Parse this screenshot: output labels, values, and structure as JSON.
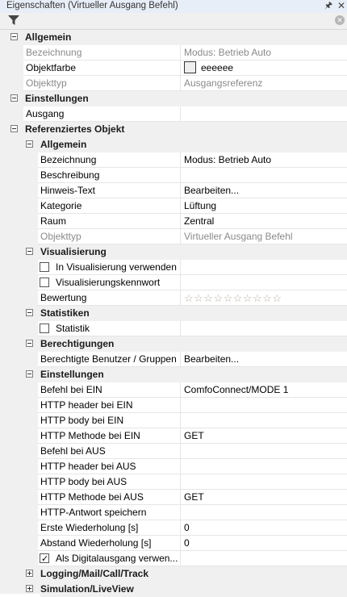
{
  "window": {
    "title": "Eigenschaften (Virtueller Ausgang Befehl)",
    "pin_icon": "pin-icon",
    "close_icon": "close-icon"
  },
  "toolbar": {
    "filter_icon": "filter-icon",
    "clear_icon": "clear-icon"
  },
  "properties": {
    "allgemein": {
      "header": "Allgemein",
      "bezeichnung": {
        "label": "Bezeichnung",
        "value": "Modus: Betrieb Auto"
      },
      "objektfarbe": {
        "label": "Objektfarbe",
        "value": "eeeeee",
        "color": "#eeeeee"
      },
      "objekttyp": {
        "label": "Objekttyp",
        "value": "Ausgangsreferenz"
      }
    },
    "einstellungen": {
      "header": "Einstellungen",
      "ausgang": {
        "label": "Ausgang",
        "value": ""
      }
    },
    "ref": {
      "header": "Referenziertes Objekt",
      "allgemein": {
        "header": "Allgemein",
        "bezeichnung": {
          "label": "Bezeichnung",
          "value": "Modus: Betrieb Auto"
        },
        "beschreibung": {
          "label": "Beschreibung",
          "value": ""
        },
        "hinweis": {
          "label": "Hinweis-Text",
          "value": "Bearbeiten..."
        },
        "kategorie": {
          "label": "Kategorie",
          "value": "Lüftung"
        },
        "raum": {
          "label": "Raum",
          "value": "Zentral"
        },
        "objekttyp": {
          "label": "Objekttyp",
          "value": "Virtueller Ausgang Befehl"
        }
      },
      "visualisierung": {
        "header": "Visualisierung",
        "in_vis": {
          "label": "In Visualisierung verwenden",
          "checked": false
        },
        "kennwort": {
          "label": "Visualisierungskennwort",
          "checked": false
        },
        "bewertung": {
          "label": "Bewertung",
          "stars": "☆☆☆☆☆☆☆☆☆☆",
          "rating": 0,
          "max": 10
        }
      },
      "statistiken": {
        "header": "Statistiken",
        "statistik": {
          "label": "Statistik",
          "checked": false
        }
      },
      "berechtigungen": {
        "header": "Berechtigungen",
        "benutzer": {
          "label": "Berechtigte Benutzer / Gruppen",
          "value": "Bearbeiten..."
        }
      },
      "einstellungen": {
        "header": "Einstellungen",
        "befehl_ein": {
          "label": "Befehl bei EIN",
          "value": "ComfoConnect/MODE 1"
        },
        "header_ein": {
          "label": "HTTP header bei EIN",
          "value": ""
        },
        "body_ein": {
          "label": "HTTP body bei EIN",
          "value": ""
        },
        "methode_ein": {
          "label": "HTTP Methode bei EIN",
          "value": "GET"
        },
        "befehl_aus": {
          "label": "Befehl bei AUS",
          "value": ""
        },
        "header_aus": {
          "label": "HTTP header bei AUS",
          "value": ""
        },
        "body_aus": {
          "label": "HTTP body bei AUS",
          "value": ""
        },
        "methode_aus": {
          "label": "HTTP Methode bei AUS",
          "value": "GET"
        },
        "antwort": {
          "label": "HTTP-Antwort speichern",
          "value": ""
        },
        "erste_wdh": {
          "label": "Erste Wiederholung [s]",
          "value": "0"
        },
        "abstand_wdh": {
          "label": "Abstand Wiederholung [s]",
          "value": "0"
        },
        "digital": {
          "label": "Als Digitalausgang verwen...",
          "checked": true,
          "check_glyph": "✓"
        }
      },
      "logging": {
        "header": "Logging/Mail/Call/Track"
      },
      "simulation": {
        "header": "Simulation/LiveView"
      }
    }
  }
}
